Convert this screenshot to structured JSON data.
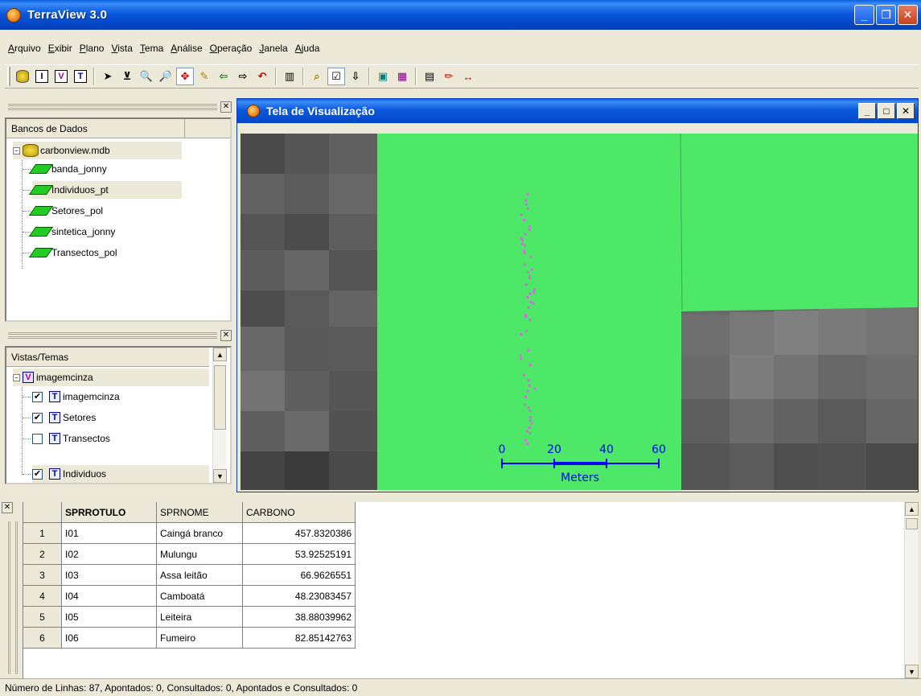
{
  "window": {
    "title": "TerraView 3.0"
  },
  "menu": [
    "Arquivo",
    "Exibir",
    "Plano",
    "Vista",
    "Tema",
    "Análise",
    "Operação",
    "Janela",
    "Ajuda"
  ],
  "toolbar_icons": [
    "database-icon",
    "infolayer-I-icon",
    "view-V-icon",
    "theme-T-icon",
    "pointer-icon",
    "zoom-area-icon",
    "zoom-in-icon",
    "zoom-out-icon",
    "pan-icon",
    "draw-icon",
    "back-icon",
    "forward-icon",
    "undo-icon",
    "table-icon",
    "query-icon",
    "select-icon",
    "filter-icon",
    "display-icon",
    "graph-icon",
    "legend-icon",
    "edit-icon",
    "measure-icon"
  ],
  "toolbar_letters": {
    "i": "I",
    "v": "V",
    "t": "T"
  },
  "databases_panel": {
    "header": "Bancos de Dados",
    "root": "carbonview.mdb",
    "layers": [
      "banda_jonny",
      "Individuos_pt",
      "Setores_pol",
      "sintetica_jonny",
      "Transectos_pol"
    ]
  },
  "views_panel": {
    "header": "Vistas/Temas",
    "view": "imagemcinza",
    "view_letter": "V",
    "theme_letter": "T",
    "themes": [
      {
        "name": "imagemcinza",
        "checked": true
      },
      {
        "name": "Setores",
        "checked": true
      },
      {
        "name": "Transectos",
        "checked": false
      },
      {
        "name": "Individuos",
        "checked": true
      }
    ]
  },
  "map_window": {
    "title": "Tela de Visualização",
    "scale": {
      "ticks": [
        "0",
        "20",
        "40",
        "60"
      ],
      "unit": "Meters"
    },
    "colors": {
      "vegetation": "#4de867",
      "points": "#d070d8",
      "scalebar": "#0000ff"
    }
  },
  "table": {
    "columns": [
      "SPRROTULO",
      "SPRNOME",
      "CARBONO"
    ],
    "rows": [
      {
        "n": "1",
        "id": "I01",
        "name": "Caingá branco",
        "carbon": "457.8320386"
      },
      {
        "n": "2",
        "id": "I02",
        "name": "Mulungu",
        "carbon": "53.92525191"
      },
      {
        "n": "3",
        "id": "I03",
        "name": "Assa leitão",
        "carbon": "66.9626551"
      },
      {
        "n": "4",
        "id": "I04",
        "name": "Camboatá",
        "carbon": "48.23083457"
      },
      {
        "n": "5",
        "id": "I05",
        "name": "Leiteira",
        "carbon": "38.88039962"
      },
      {
        "n": "6",
        "id": "I06",
        "name": "Fumeiro",
        "carbon": "82.85142763"
      }
    ]
  },
  "status": "Número de Linhas: 87, Apontados: 0, Consultados: 0, Apontados e Consultados: 0"
}
